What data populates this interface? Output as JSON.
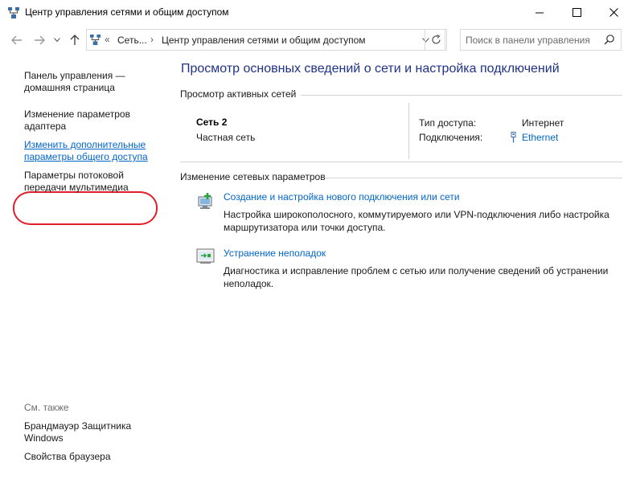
{
  "window": {
    "title": "Центр управления сетями и общим доступом",
    "minimize_glyph": "—",
    "maximize_glyph": "☐",
    "close_glyph": "✕"
  },
  "address_bar": {
    "overflow": "«",
    "crumbs": [
      "Сеть...",
      "Центр управления сетями и общим доступом"
    ],
    "separator": "›"
  },
  "search": {
    "placeholder": "Поиск в панели управления",
    "value": ""
  },
  "sidebar": {
    "items": [
      {
        "label": "Панель управления — домашняя страница"
      },
      {
        "label": "Изменение параметров адаптера"
      },
      {
        "label": "Изменить дополнительные параметры общего доступа"
      },
      {
        "label": "Параметры потоковой передачи мультимедиа"
      }
    ],
    "see_also_title": "См. также",
    "see_also": [
      {
        "label": "Брандмауэр Защитника Windows"
      },
      {
        "label": "Свойства браузера"
      }
    ]
  },
  "main": {
    "heading": "Просмотр основных сведений о сети и настройка подключений",
    "active_networks_title": "Просмотр активных сетей",
    "network": {
      "name": "Сеть 2",
      "type": "Частная сеть",
      "access_label": "Тип доступа:",
      "access_value": "Интернет",
      "connections_label": "Подключения:",
      "connections_value": "Ethernet"
    },
    "change_settings_title": "Изменение сетевых параметров",
    "tasks": [
      {
        "link": "Создание и настройка нового подключения или сети",
        "desc": "Настройка широкополосного, коммутируемого или VPN-подключения либо настройка маршрутизатора или точки доступа."
      },
      {
        "link": "Устранение неполадок",
        "desc": "Диагностика и исправление проблем с сетью или получение сведений об устранении неполадок."
      }
    ]
  },
  "colors": {
    "link": "#0066cc",
    "heading": "#1e3287",
    "highlight": "#e01f2b"
  }
}
